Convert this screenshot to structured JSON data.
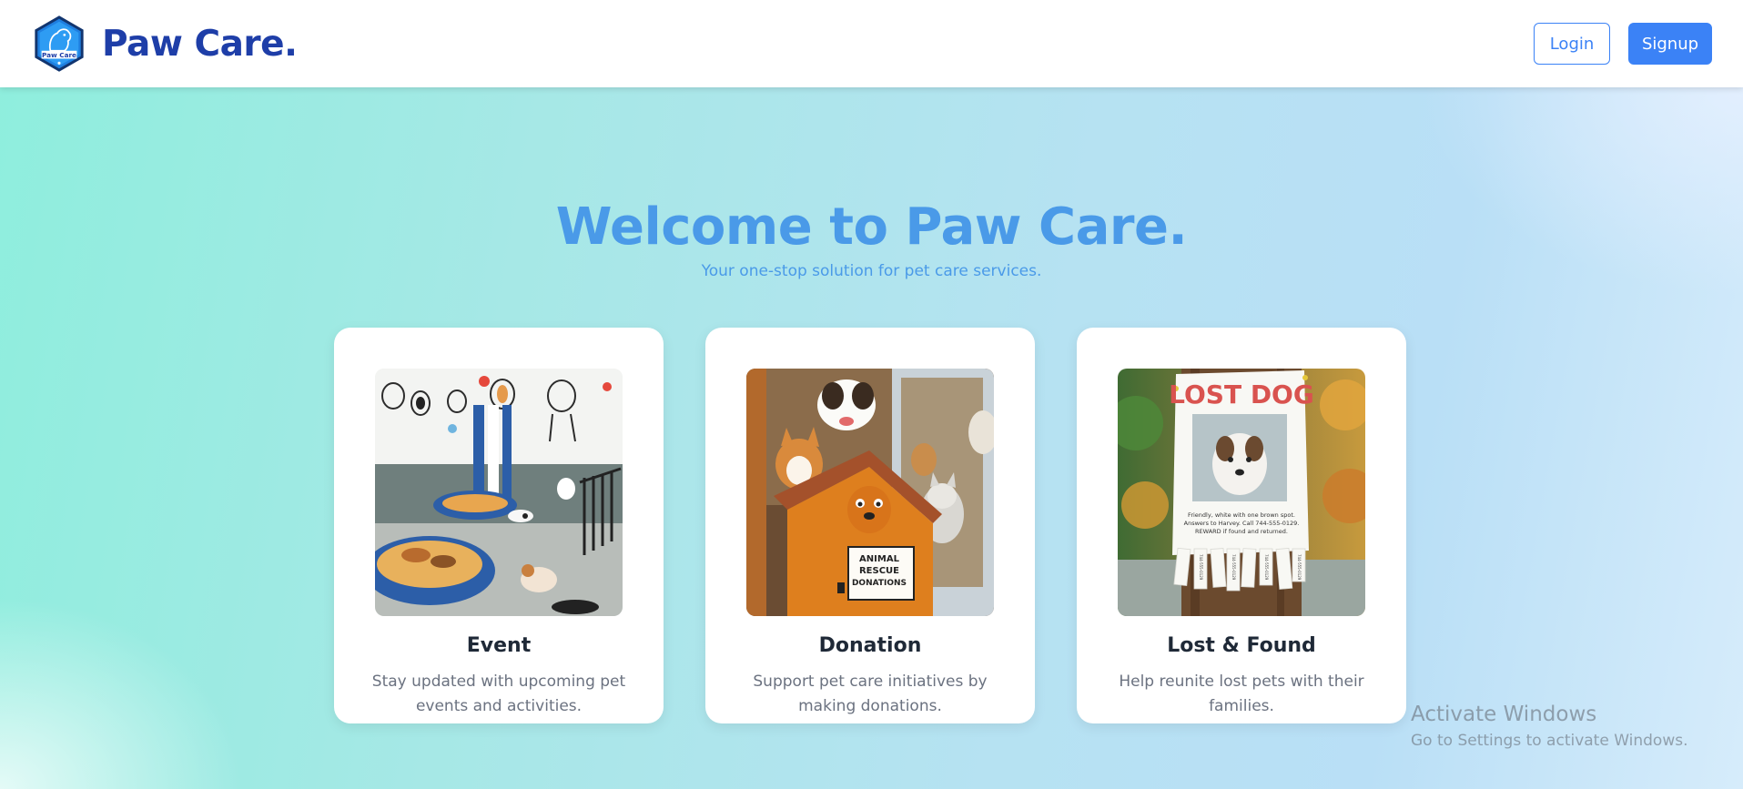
{
  "header": {
    "brand_name": "Paw Care.",
    "logo_text": "Paw Care",
    "login_label": "Login",
    "signup_label": "Signup"
  },
  "hero": {
    "title": "Welcome to Paw Care.",
    "subtitle": "Your one-stop solution for pet care services."
  },
  "cards": [
    {
      "title": "Event",
      "description": "Stay updated with upcoming pet events and activities."
    },
    {
      "title": "Donation",
      "description": "Support pet care initiatives by making donations."
    },
    {
      "title": "Lost & Found",
      "description": "Help reunite lost pets with their families.",
      "poster": {
        "heading": "LOST DOG",
        "lines": [
          "Friendly, white with one brown spot.",
          "Answers to Harvey. Call 744-555-0129.",
          "REWARD if found and returned."
        ],
        "tab_text": "744-555-0129"
      }
    }
  ],
  "donation_sign": [
    "ANIMAL",
    "RESCUE",
    "DONATIONS"
  ],
  "watermark": {
    "title": "Activate Windows",
    "subtitle": "Go to Settings to activate Windows."
  },
  "colors": {
    "brand": "#1e3ea8",
    "accent": "#3b82f6",
    "hero_text": "#4a9ae8",
    "card_title": "#1f2937",
    "card_desc": "#6b7280"
  }
}
